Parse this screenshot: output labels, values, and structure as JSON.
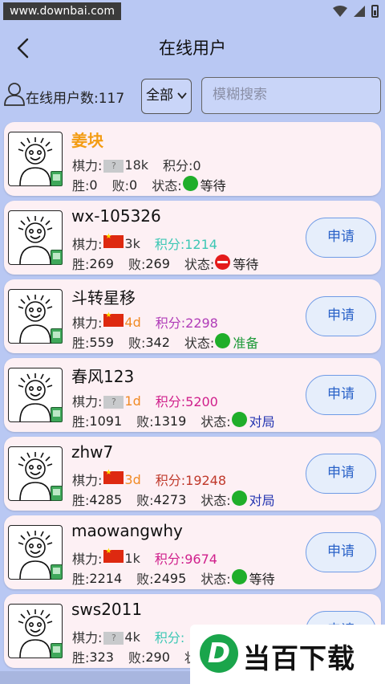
{
  "statusbar": {
    "watermark": "www.downbai.com"
  },
  "header": {
    "title": "在线用户"
  },
  "controls": {
    "user_count": "在线用户数:117",
    "filter_value": "全部",
    "search_placeholder": "模糊搜索"
  },
  "labels": {
    "strength": "棋力:",
    "score_prefix": "积分:",
    "win": "胜:",
    "loss": "败:",
    "state": "状态:",
    "apply": "申请"
  },
  "colors": {
    "background": "#b9c8f3",
    "card": "#fdf0f4",
    "online_dot": "#1fae2a",
    "busy_dot": "#e41b1b",
    "apply_text": "#2a62c8"
  },
  "users": [
    {
      "name": "姜块",
      "name_color": "#f39c12",
      "flag": "unknown",
      "strength": "18k",
      "strength_color": "#333333",
      "score": "积分:0",
      "score_color": "#333333",
      "wins": "0",
      "losses": "0",
      "status_icon": "online",
      "status": "等待",
      "status_color": "#222222",
      "apply": false
    },
    {
      "name": "wx-105326",
      "name_color": "#111111",
      "flag": "china",
      "strength": "3k",
      "strength_color": "#333333",
      "score": "积分:1214",
      "score_color": "#3cc7b4",
      "wins": "269",
      "losses": "269",
      "status_icon": "busy",
      "status": "等待",
      "status_color": "#222222",
      "apply": true
    },
    {
      "name": "斗转星移",
      "name_color": "#111111",
      "flag": "china",
      "strength": "4d",
      "strength_color": "#f08a24",
      "score": "积分:2298",
      "score_color": "#b03cb8",
      "wins": "559",
      "losses": "342",
      "status_icon": "online",
      "status": "准备",
      "status_color": "#1f9a3a",
      "apply": true
    },
    {
      "name": "春风123",
      "name_color": "#111111",
      "flag": "unknown",
      "strength": "1d",
      "strength_color": "#f08a24",
      "score": "积分:5200",
      "score_color": "#d0208c",
      "wins": "1091",
      "losses": "1319",
      "status_icon": "online",
      "status": "对局",
      "status_color": "#2233b0",
      "apply": true
    },
    {
      "name": "zhw7",
      "name_color": "#111111",
      "flag": "china",
      "strength": "3d",
      "strength_color": "#f08a24",
      "score": "积分:19248",
      "score_color": "#c0392b",
      "wins": "4285",
      "losses": "4273",
      "status_icon": "online",
      "status": "对局",
      "status_color": "#2233b0",
      "apply": true
    },
    {
      "name": "maowangwhy",
      "name_color": "#111111",
      "flag": "china",
      "strength": "1k",
      "strength_color": "#333333",
      "score": "积分:9674",
      "score_color": "#d0208c",
      "wins": "2214",
      "losses": "2495",
      "status_icon": "online",
      "status": "等待",
      "status_color": "#222222",
      "apply": true
    },
    {
      "name": "sws2011",
      "name_color": "#111111",
      "flag": "unknown",
      "strength": "4k",
      "strength_color": "#333333",
      "score": "积分:",
      "score_color": "#3cc7b4",
      "wins": "323",
      "losses": "290",
      "status_icon": "",
      "status": "",
      "status_color": "#222222",
      "apply": true
    }
  ],
  "brand_watermark": {
    "text": "当百下载",
    "logo": "D"
  }
}
